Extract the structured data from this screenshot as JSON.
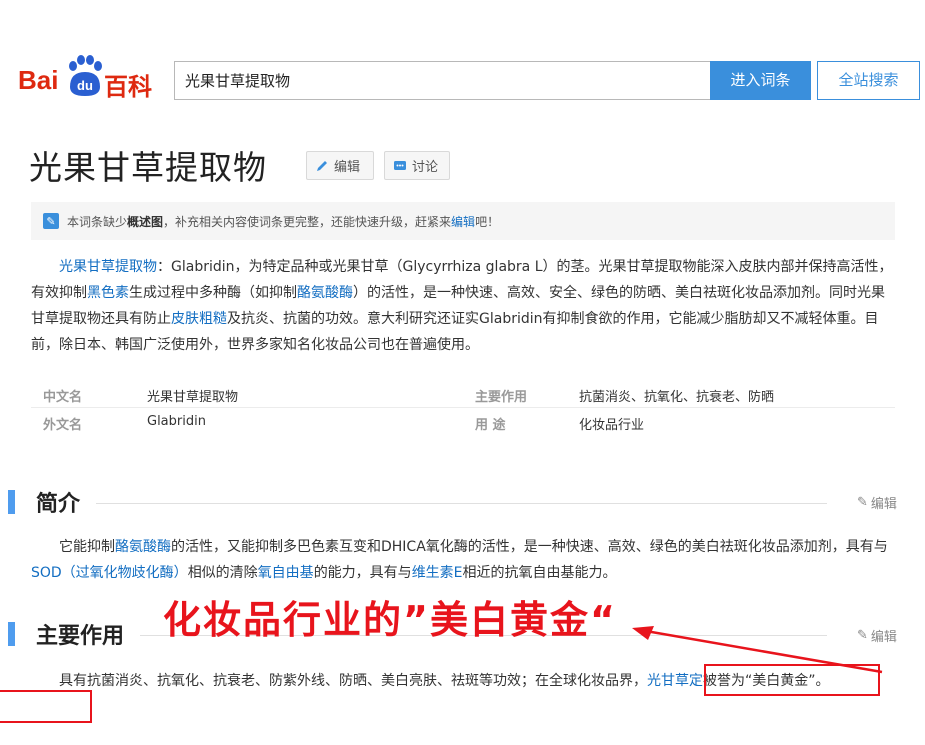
{
  "header": {
    "logo_left": "Bai",
    "logo_paw": "du",
    "logo_right": "百科",
    "search_value": "光果甘草提取物",
    "enter_button": "进入词条",
    "site_search_button": "全站搜索"
  },
  "entry": {
    "title": "光果甘草提取物",
    "edit_label": "编辑",
    "discuss_label": "讨论"
  },
  "notice": {
    "text_1": "本词条缺少",
    "bold": "概述图",
    "text_2": "，补充相关内容使词条更完整，还能快速升级，赶紧来",
    "link": "编辑",
    "text_3": "吧！"
  },
  "summary": {
    "s1": "光果甘草提取物",
    "s2": "：Glabridin，为特定品种或光果甘草（Glycyrrhiza glabra L）的茎。光果甘草提取物能深入皮肤内部并保持高活性，有效抑制",
    "s3": "黑色素",
    "s4": "生成过程中多种酶（如抑制",
    "s5": "酪氨酸酶",
    "s6": "）的活性，是一种快速、高效、安全、绿色的防晒、美白祛斑化妆品添加剂。同时光果甘草提取物还具有防止",
    "s7": "皮肤粗糙",
    "s8": "及抗炎、抗菌的功效。意大利研究还证实Glabridin有抑制食欲的作用，它能减少脂肪却又不减轻体重。目前，除日本、韩国广泛使用外，世界多家知名化妆品公司也在普遍使用。"
  },
  "info_table": [
    {
      "k1": "中文名",
      "v1": "光果甘草提取物",
      "k2": "主要作用",
      "v2": "抗菌消炎、抗氧化、抗衰老、防晒"
    },
    {
      "k1": "外文名",
      "v1": "Glabridin",
      "k2": "用 途",
      "v2": "化妆品行业"
    }
  ],
  "section_intro": {
    "title": "简介",
    "edit": "编辑",
    "p1": "它能抑制",
    "p2": "酪氨酸酶",
    "p3": "的活性，又能抑制多巴色素互变和DHICA氧化酶的活性，是一种快速、高效、绿色的美白祛斑化妆品添加剂，具有与",
    "p4": "SOD（过氧化物歧化酶）",
    "p5": "相似的清除",
    "p6": "氧自由基",
    "p7": "的能力，具有与",
    "p8": "维生素E",
    "p9": "相近的抗氧自由基能力。"
  },
  "section_main": {
    "title": "主要作用",
    "edit": "编辑",
    "p1": "具有抗菌消炎、抗氧化、抗衰老、防紫外线、防晒、美白亮肤、祛斑等功效；在全球化妆品界，",
    "p2": "光甘草定",
    "p3": "被誉为“美白黄金”。"
  },
  "annotation": {
    "text": "化妆品行业的”美白黄金“",
    "color": "#e8141c"
  },
  "colors": {
    "accent": "#3a8fdc",
    "link": "#136ec2",
    "section_bar": "#4f9cee",
    "brand_red": "#de2910"
  }
}
